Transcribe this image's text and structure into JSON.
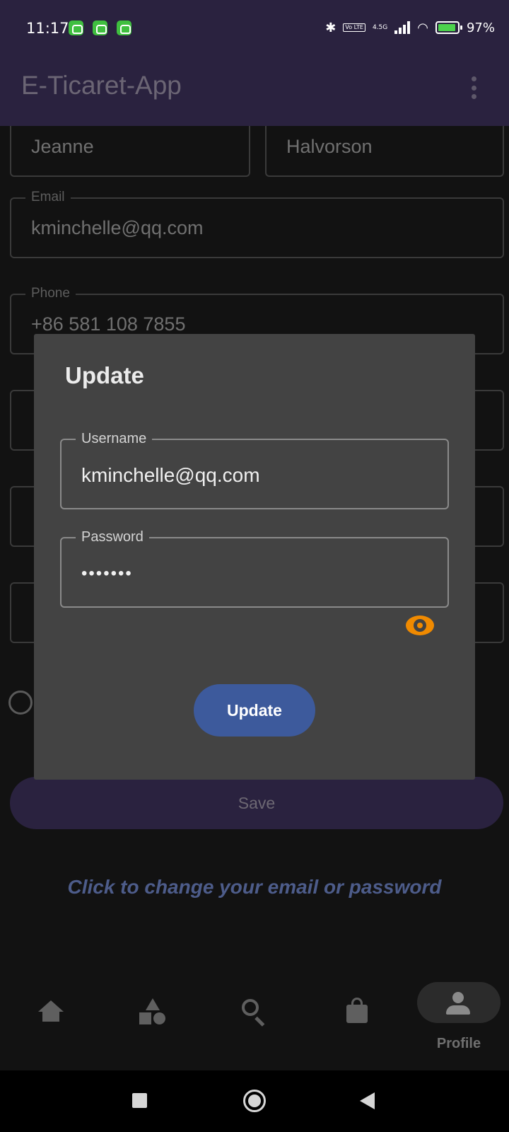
{
  "status_bar": {
    "time": "11:17",
    "network_type": "4.5G",
    "volte": "Vo LTE",
    "battery": "97%"
  },
  "app_bar": {
    "title": "E-Ticaret-App"
  },
  "form": {
    "first_name": "Jeanne",
    "last_name": "Halvorson",
    "email_label": "Email",
    "email_value": "kminchelle@qq.com",
    "phone_label": "Phone",
    "phone_value": "+86 581 108 7855",
    "save_label": "Save",
    "change_link": "Click to change your email or password"
  },
  "dialog": {
    "title": "Update",
    "username_label": "Username",
    "username_value": "kminchelle@qq.com",
    "password_label": "Password",
    "password_value": "•••••••",
    "update_label": "Update"
  },
  "bottom_nav": {
    "items": [
      {
        "icon": "home-icon"
      },
      {
        "icon": "categories-icon"
      },
      {
        "icon": "search-icon"
      },
      {
        "icon": "shopping-bag-icon"
      },
      {
        "icon": "person-icon",
        "label": "Profile",
        "selected": true
      }
    ]
  },
  "colors": {
    "app_bar": "#2a223f",
    "dialog_bg": "#434343",
    "update_button": "#3d5a9c",
    "eye_icon": "#f08a00",
    "link": "#4d5c8a"
  }
}
